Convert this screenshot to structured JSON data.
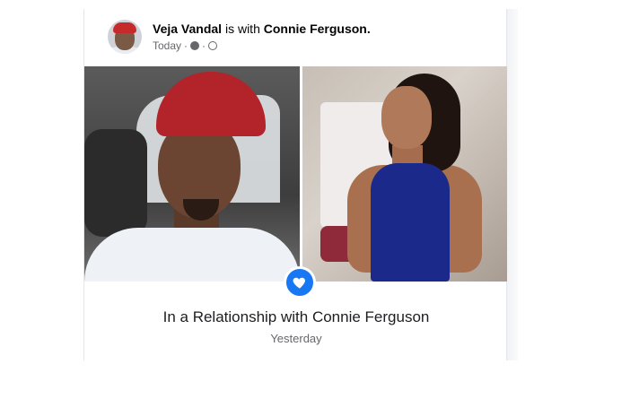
{
  "post": {
    "author": "Veja Vandal",
    "with_text": "is with",
    "tagged": "Connie Ferguson.",
    "time": "Today",
    "separator": "·"
  },
  "event": {
    "title": "In a Relationship with Connie Ferguson",
    "date": "Yesterday"
  },
  "icons": {
    "badge": "heart-icon",
    "privacy": "globe-icon",
    "clock": "clock-icon"
  },
  "colors": {
    "accent": "#1877f2",
    "text": "#1c1e21",
    "muted": "#65676b"
  }
}
